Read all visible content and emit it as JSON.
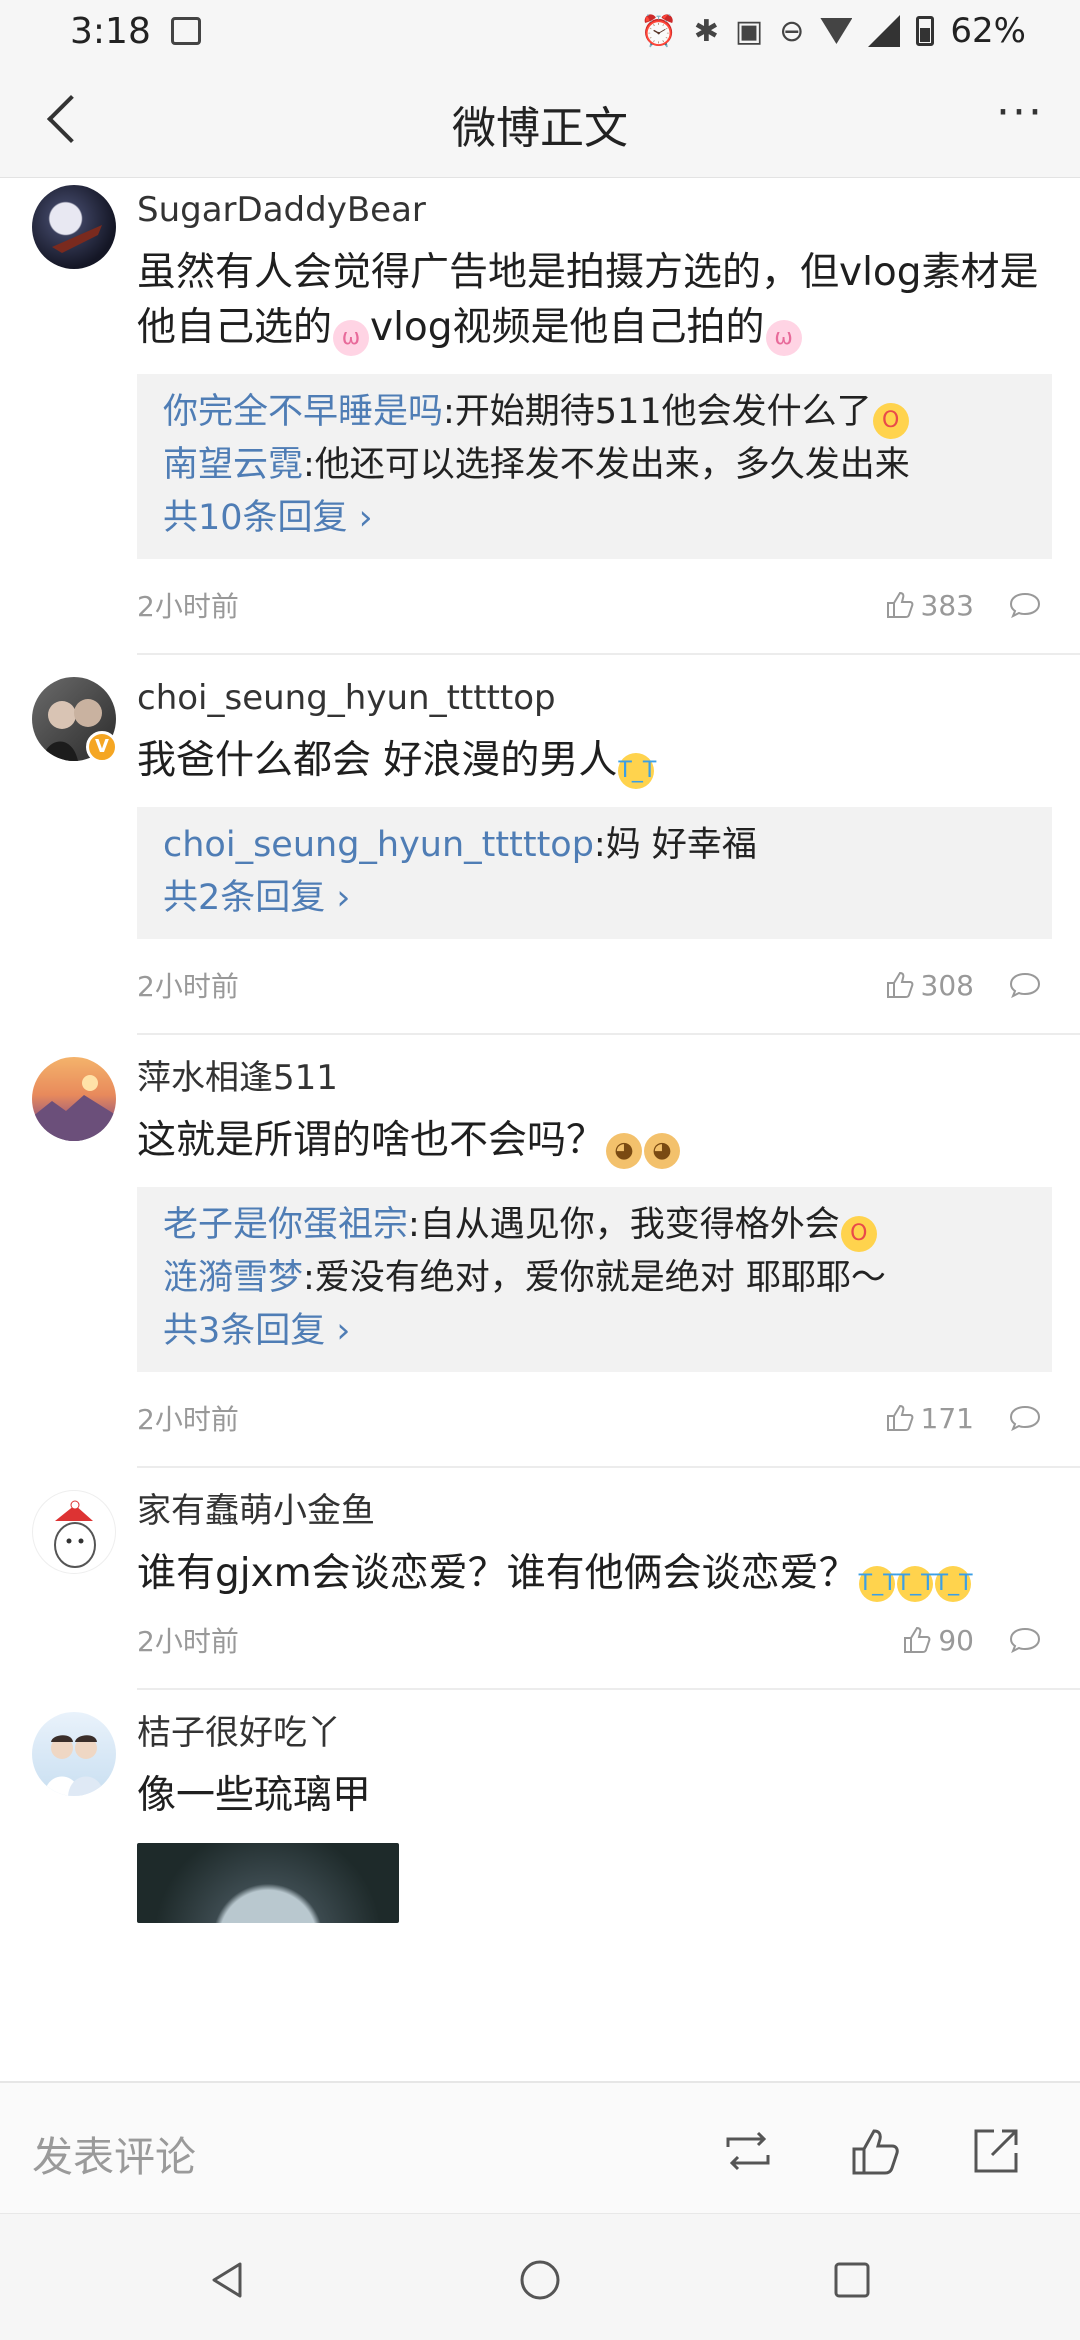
{
  "status_bar": {
    "time": "3:18",
    "battery": "62%"
  },
  "header": {
    "title": "微博正文",
    "more": "···"
  },
  "comments": [
    {
      "username": "SugarDaddyBear",
      "text_parts": [
        "虽然有人会觉得广告地是拍摄方选的，但vlog素材是他自己选的",
        "vlog视频是他自己拍的"
      ],
      "emoji": "rabbit",
      "replies": [
        {
          "name": "你完全不早睡是吗",
          "text": ":开始期待511他会发什么了",
          "emoji": "scream"
        },
        {
          "name": "南望云霓",
          "text": ":他还可以选择发不发出来，多久发出来"
        }
      ],
      "more_replies": "共10条回复",
      "time": "2小时前",
      "likes": "383"
    },
    {
      "username": "choi_seung_hyun_tttttop",
      "text": "我爸什么都会 好浪漫的男人",
      "emoji": "cry",
      "replies": [
        {
          "name": "choi_seung_hyun_tttttop",
          "text": ":妈 好幸福"
        }
      ],
      "more_replies": "共2条回复",
      "time": "2小时前",
      "likes": "308"
    },
    {
      "username": "萍水相逢511",
      "text": "这就是所谓的啥也不会吗？",
      "emoji": "dog",
      "replies": [
        {
          "name": "老子是你蛋祖宗",
          "text": ":自从遇见你，我变得格外会",
          "emoji": "scream"
        },
        {
          "name": "涟漪雪梦",
          "text": ":爱没有绝对，爱你就是绝对 耶耶耶～"
        }
      ],
      "more_replies": "共3条回复",
      "time": "2小时前",
      "likes": "171"
    },
    {
      "username": "家有蠢萌小金鱼",
      "text": "谁有gjxm会谈恋爱？谁有他俩会谈恋爱？",
      "emoji": "cry",
      "time": "2小时前",
      "likes": "90"
    },
    {
      "username": "桔子很好吃丫",
      "text": "像一些琉璃甲"
    }
  ],
  "input_bar": {
    "placeholder": "发表评论"
  },
  "icons": {
    "back": "back-arrow-icon",
    "repost": "repost-icon",
    "like": "thumbs-up-icon",
    "share": "share-icon",
    "reply": "comment-bubble-icon"
  },
  "colors": {
    "link": "#4f7db5",
    "meta": "#999999",
    "reply_bg": "#f2f2f2"
  }
}
